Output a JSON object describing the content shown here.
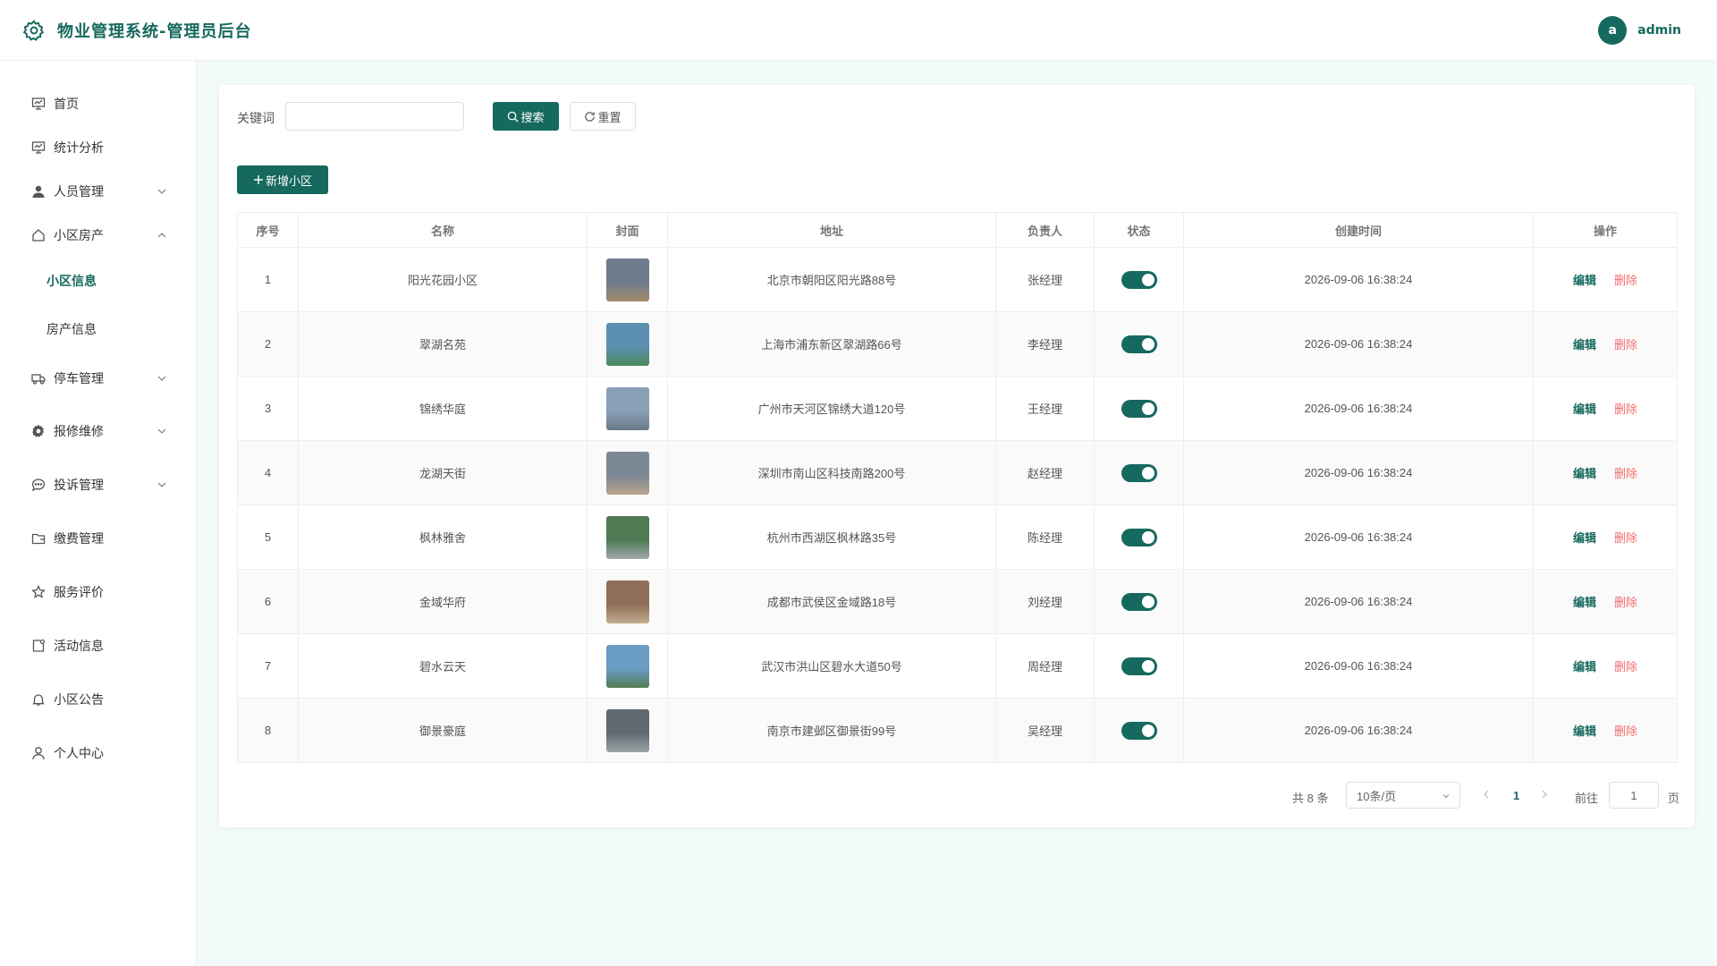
{
  "header": {
    "title": "物业管理系统-管理员后台",
    "avatar_letter": "a",
    "username": "admin"
  },
  "sidebar": {
    "items": [
      {
        "label": "首页"
      },
      {
        "label": "统计分析"
      },
      {
        "label": "人员管理"
      },
      {
        "label": "小区房产"
      },
      {
        "label": "小区信息"
      },
      {
        "label": "房产信息"
      },
      {
        "label": "停车管理"
      },
      {
        "label": "报修维修"
      },
      {
        "label": "投诉管理"
      },
      {
        "label": "缴费管理"
      },
      {
        "label": "服务评价"
      },
      {
        "label": "活动信息"
      },
      {
        "label": "小区公告"
      },
      {
        "label": "个人中心"
      }
    ]
  },
  "search": {
    "label": "关键词",
    "value": "",
    "search_btn": "搜索",
    "reset_btn": "重置"
  },
  "toolbar": {
    "add_btn": "新增小区"
  },
  "table": {
    "columns": [
      "序号",
      "名称",
      "封面",
      "地址",
      "负责人",
      "状态",
      "创建时间",
      "操作"
    ],
    "rows": [
      {
        "index": "1",
        "name": "阳光花园小区",
        "address": "北京市朝阳区阳光路88号",
        "manager": "张经理",
        "status": true,
        "created": "2026-09-06 16:38:24"
      },
      {
        "index": "2",
        "name": "翠湖名苑",
        "address": "上海市浦东新区翠湖路66号",
        "manager": "李经理",
        "status": true,
        "created": "2026-09-06 16:38:24"
      },
      {
        "index": "3",
        "name": "锦绣华庭",
        "address": "广州市天河区锦绣大道120号",
        "manager": "王经理",
        "status": true,
        "created": "2026-09-06 16:38:24"
      },
      {
        "index": "4",
        "name": "龙湖天街",
        "address": "深圳市南山区科技南路200号",
        "manager": "赵经理",
        "status": true,
        "created": "2026-09-06 16:38:24"
      },
      {
        "index": "5",
        "name": "枫林雅舍",
        "address": "杭州市西湖区枫林路35号",
        "manager": "陈经理",
        "status": true,
        "created": "2026-09-06 16:38:24"
      },
      {
        "index": "6",
        "name": "金域华府",
        "address": "成都市武侯区金域路18号",
        "manager": "刘经理",
        "status": true,
        "created": "2026-09-06 16:38:24"
      },
      {
        "index": "7",
        "name": "碧水云天",
        "address": "武汉市洪山区碧水大道50号",
        "manager": "周经理",
        "status": true,
        "created": "2026-09-06 16:38:24"
      },
      {
        "index": "8",
        "name": "御景豪庭",
        "address": "南京市建邺区御景街99号",
        "manager": "吴经理",
        "status": true,
        "created": "2026-09-06 16:38:24"
      }
    ],
    "edit_label": "编辑",
    "delete_label": "删除"
  },
  "pagination": {
    "total_text": "共 8 条",
    "page_size": "10条/页",
    "current_page": "1",
    "goto_label": "前往",
    "goto_value": "1",
    "page_unit": "页"
  },
  "colors": {
    "primary": "#16695e",
    "danger": "#f56c6c",
    "background": "#f3fbf9"
  }
}
